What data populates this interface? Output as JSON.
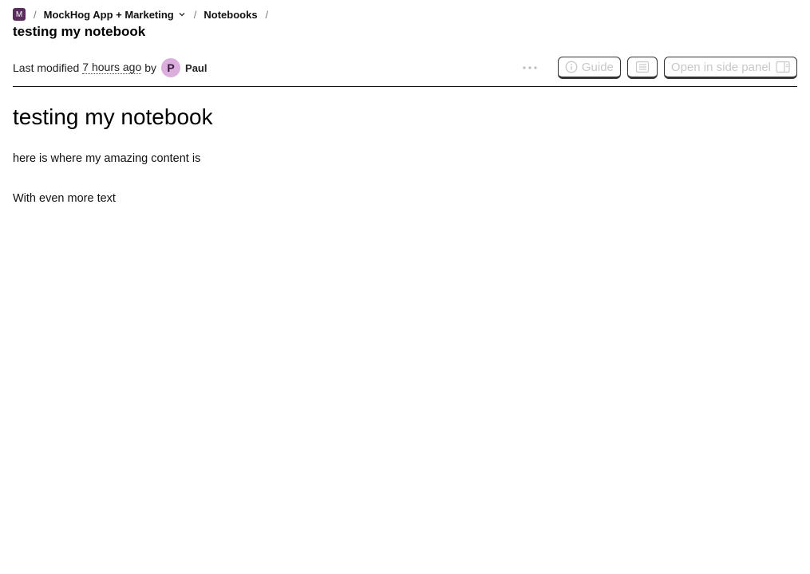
{
  "breadcrumb": {
    "project_initial": "M",
    "project_name": "MockHog App + Marketing",
    "separator": "/",
    "section": "Notebooks"
  },
  "page": {
    "title": "testing my notebook"
  },
  "meta": {
    "last_modified_label": "Last modified",
    "time_ago": "7 hours ago",
    "by_label": "by",
    "user_initial": "P",
    "user_name": "Paul"
  },
  "toolbar": {
    "guide_label": "Guide",
    "side_panel_label": "Open in side panel"
  },
  "notebook": {
    "heading": "testing my notebook",
    "paragraphs": [
      "here is where my amazing content is",
      "With even more text"
    ]
  },
  "colors": {
    "project_avatar": "#5b2d5e",
    "user_avatar": "#dcaede",
    "disabled_text": "#c8c8c8"
  }
}
